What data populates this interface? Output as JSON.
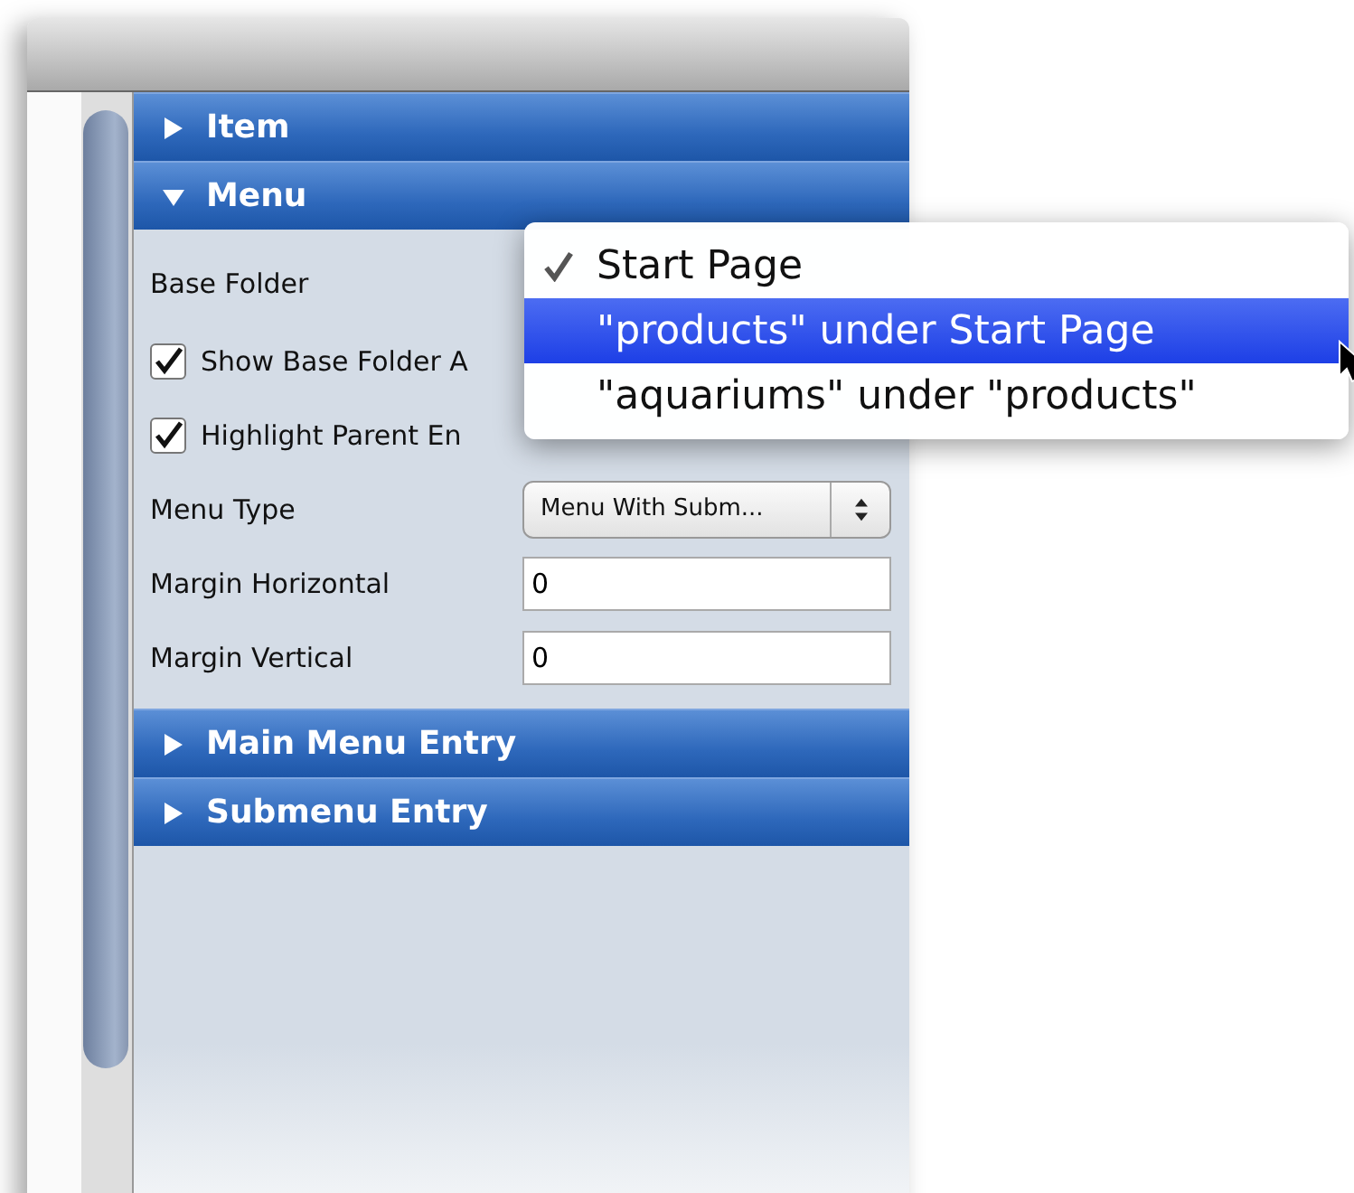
{
  "sections": [
    {
      "title": "Item",
      "expanded": false
    },
    {
      "title": "Menu",
      "expanded": true,
      "fields": [
        {
          "kind": "label",
          "label": "Base Folder"
        },
        {
          "kind": "checkbox",
          "label": "Show Base Folder A",
          "checked": true
        },
        {
          "kind": "checkbox",
          "label": "Highlight Parent En",
          "checked": true
        },
        {
          "kind": "dropdown",
          "label": "Menu Type",
          "value": "Menu With Subm..."
        },
        {
          "kind": "text",
          "label": "Margin Horizontal",
          "value": "0"
        },
        {
          "kind": "text",
          "label": "Margin Vertical",
          "value": "0"
        }
      ]
    },
    {
      "title": "Main Menu Entry",
      "expanded": false
    },
    {
      "title": "Submenu Entry",
      "expanded": false
    }
  ],
  "popup_menu": {
    "items": [
      {
        "label": "Start Page",
        "checked": true,
        "selected": false
      },
      {
        "label": "\"products\" under Start Page",
        "checked": false,
        "selected": true
      },
      {
        "label": "\"aquariums\" under \"products\"",
        "checked": false,
        "selected": false
      }
    ]
  }
}
